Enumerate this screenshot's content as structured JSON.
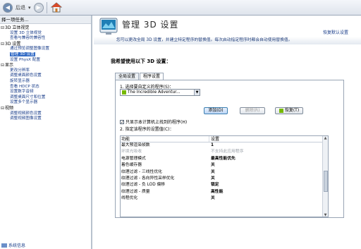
{
  "toolbar": {
    "back_label": "后退",
    "back_symbol": "◀",
    "forward_symbol": "▶",
    "dropdown_symbol": "▾",
    "home_symbol": "⌂"
  },
  "sidebar": {
    "header": "择一项任务...",
    "categories": [
      {
        "toggle": "⊟",
        "label": "3D 立体视觉",
        "items": [
          "设置 3D 立体视觉",
          "查看与兼容的兼容性"
        ]
      },
      {
        "toggle": "⊟",
        "label": "3D 设置",
        "items": [
          "通过预览调整图像设置",
          "管理 3D 设置",
          "设置 PhysX 配置"
        ]
      },
      {
        "toggle": "⊟",
        "label": "显示",
        "items": [
          "更改分辨率",
          "调整桌面颜色设置",
          "旋转显示器",
          "查看 HDCP 状态",
          "设置数字音频",
          "调整桌面尺寸和位置",
          "设置多个显示器"
        ]
      },
      {
        "toggle": "⊟",
        "label": "视频",
        "items": [
          "调整视频颜色设置",
          "调整视频图像设置"
        ]
      }
    ],
    "footer": "系统信息"
  },
  "main": {
    "title": "管理 3D 设置",
    "restore_defaults": "恢复默认设置",
    "description": "您可以更改全局 3D 设置，并建立特定程序的替换值。每次启动指定程序时都会自动使用替换值。",
    "section_title": "我希望使用以下 3D 设置：",
    "tabs": [
      "全局设置",
      "程序设置"
    ],
    "active_tab": 1,
    "step1_label": "1. 选择要自定义的程序(S)：",
    "program_selected": "The Incredible Adventur...",
    "buttons": {
      "add": "添加(D)",
      "remove": "删除(R)",
      "restore": "恢复(T)"
    },
    "checkbox": {
      "checked": true,
      "label": "只显示本计算机上找到的程序(H)"
    },
    "step2_label": "2. 指定该程序的设置值(C)：",
    "grid": {
      "columns": [
        "功能",
        "设置"
      ],
      "rows": [
        {
          "feature": "最大预渲染帧数",
          "value": "1",
          "disabled": false
        },
        {
          "feature": "环境光吸收",
          "value": "不支持此应用程序",
          "disabled": true
        },
        {
          "feature": "电源管理模式",
          "value": "最高性能优先",
          "disabled": false
        },
        {
          "feature": "着色缓存器",
          "value": "关",
          "disabled": false
        },
        {
          "feature": "纹理过滤 - 三线性优化",
          "value": "关",
          "disabled": false
        },
        {
          "feature": "纹理过滤 - 各向异性采样优化",
          "value": "关",
          "disabled": false
        },
        {
          "feature": "纹理过滤 - 负 LOD 偏移",
          "value": "锁定",
          "disabled": false
        },
        {
          "feature": "纹理过滤 - 质量",
          "value": "高性能",
          "disabled": false
        },
        {
          "feature": "线程优化",
          "value": "关",
          "disabled": false
        }
      ]
    }
  }
}
